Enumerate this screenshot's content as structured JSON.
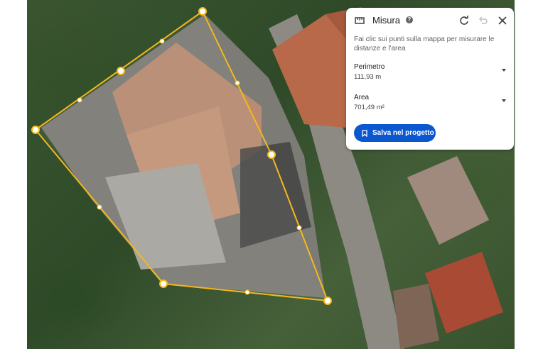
{
  "measure_panel": {
    "title": "Misura",
    "help_icon": "help-icon",
    "instructions": "Fai clic sui punti sulla mappa per misurare le distanze e l'area",
    "perimeter": {
      "label": "Perimetro",
      "value": "111,93 m"
    },
    "area": {
      "label": "Area",
      "value": "701,49 m²"
    },
    "save_button_label": "Salva nel progetto",
    "icons": [
      "ruler-icon",
      "help-icon",
      "redo-icon",
      "undo-icon",
      "close-icon",
      "chevron-down-icon",
      "bookmark-icon"
    ]
  },
  "colors": {
    "accent": "#0b57d0",
    "measure_line": "#f5b81c"
  }
}
